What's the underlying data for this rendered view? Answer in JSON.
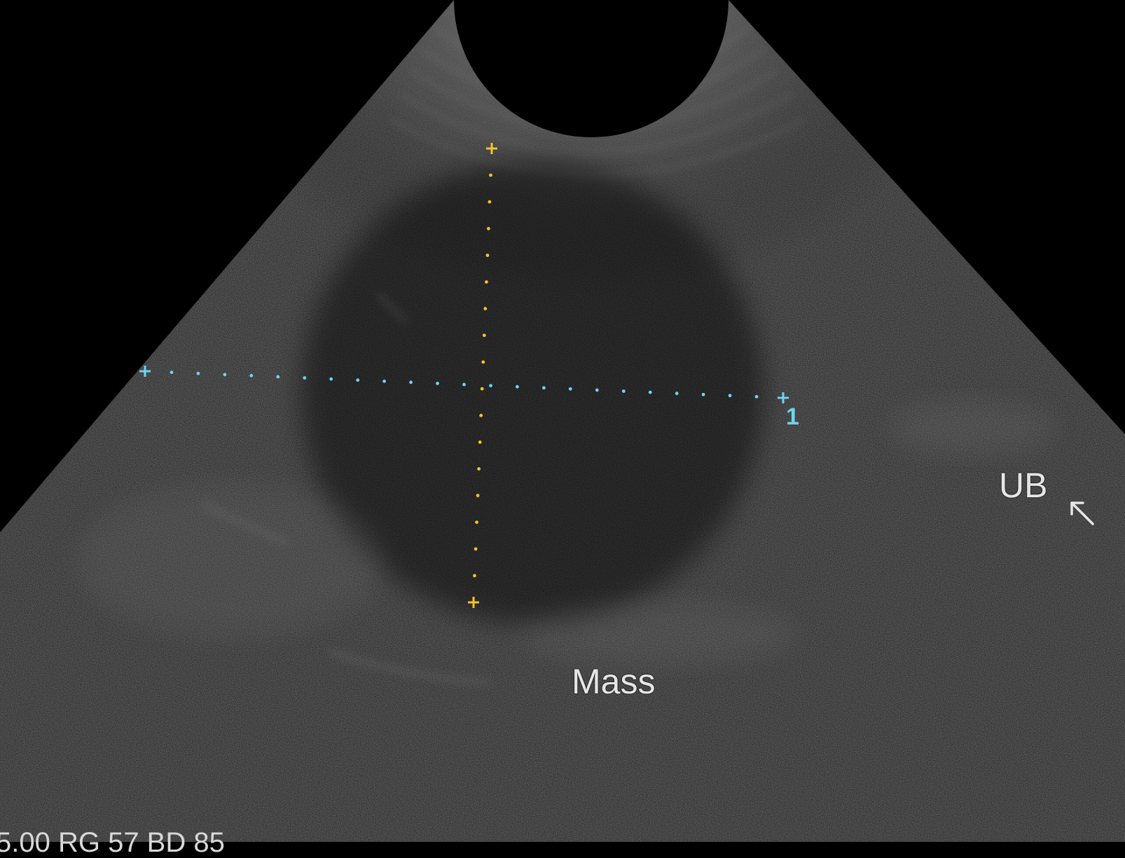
{
  "labels": {
    "mass": "Mass",
    "ub": "UB",
    "caliper_id": "1",
    "bottom_readout": "5.00 RG 57 BD 85"
  },
  "icons": {
    "pointer": "arrow-up-left-icon"
  },
  "colors": {
    "background": "#000000",
    "caliper_vertical": "#f2c230",
    "caliper_horizontal": "#6fd3ee",
    "label_text": "#e6e6e6"
  }
}
